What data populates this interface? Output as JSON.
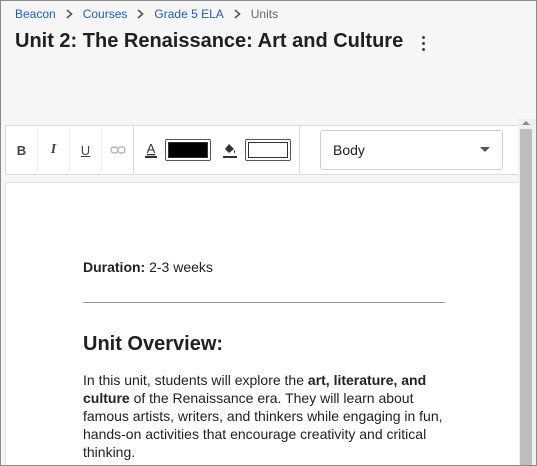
{
  "breadcrumb": [
    "Beacon",
    "Courses",
    "Grade 5 ELA",
    "Units"
  ],
  "page_title": "Unit 2: The Renaissance: Art and Culture",
  "toolbar": {
    "bold_label": "B",
    "italic_label": "I",
    "underline_label": "U",
    "text_color": "#000000",
    "highlight_color": "#ffffff",
    "style_select_value": "Body"
  },
  "document": {
    "duration_label": "Duration:",
    "duration_value": "2-3 weeks",
    "overview_heading": "Unit Overview:",
    "overview_paragraph": {
      "text_1": "In this unit, students will explore the ",
      "bold_1": "art, literature, and culture",
      "text_2": " of the Renaissance era. They will learn about famous artists, writers, and thinkers while engaging in fun, hands-on activities that encourage creativity and critical thinking."
    }
  }
}
